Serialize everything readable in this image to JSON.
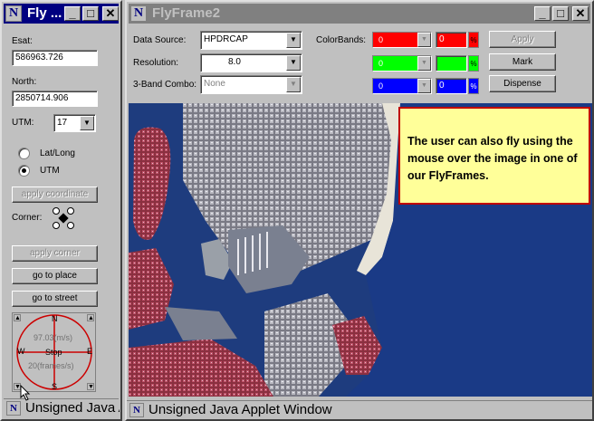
{
  "left_window": {
    "title": "Fly ...",
    "easting_label": "Esat:",
    "easting_value": "586963.726",
    "northing_label": "North:",
    "northing_value": "2850714.906",
    "utm_label": "UTM:",
    "utm_value": "17",
    "radio_latlong": "Lat/Long",
    "radio_utm": "UTM",
    "apply_coordinate": "apply coordinate",
    "corner_label": "Corner:",
    "apply_corner": "apply corner",
    "go_to_place": "go to place",
    "go_to_street": "go to street",
    "compass": {
      "north": "N",
      "south": "S",
      "east": "E",
      "west": "W",
      "speed": "97.03(m/s)",
      "stop": "Stop",
      "frames": "20(frames/s)"
    },
    "status": "Unsigned Java Applet Window"
  },
  "main_window": {
    "title": "FlyFrame2",
    "data_source_label": "Data Source:",
    "data_source_value": "HPDRCAP",
    "resolution_label": "Resolution:",
    "resolution_value": "8.0",
    "combo_label": "3-Band Combo:",
    "combo_value": "None",
    "colorbands_label": "ColorBands:",
    "bands": [
      {
        "value": "0",
        "level": "0",
        "pct": "%",
        "color": "#ff0000"
      },
      {
        "value": "0",
        "level": "",
        "pct": "%",
        "color": "#00ff00"
      },
      {
        "value": "0",
        "level": "0",
        "pct": "%",
        "color": "#0000ff"
      }
    ],
    "apply_button": "Apply",
    "mark_button": "Mark",
    "dispense_button": "Dispense",
    "callout_text": "The user can also fly using the mouse over the image in one of our FlyFrames.",
    "status": "Unsigned Java Applet Window"
  },
  "colors": {
    "titlebar": "#000080",
    "window": "#c0c0c0",
    "callout_bg": "#ffff99",
    "callout_border": "#c00000",
    "compass_circle": "#cc0000"
  }
}
